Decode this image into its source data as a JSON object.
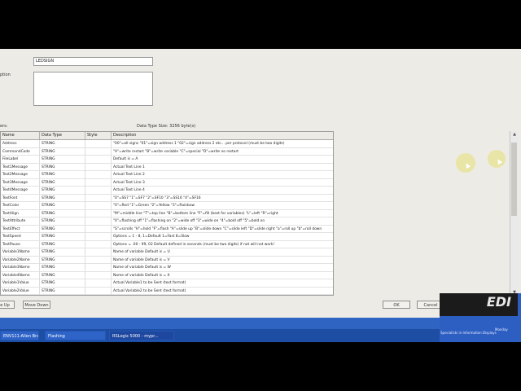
{
  "form": {
    "name_label": "",
    "name_value": "LEDSIGN",
    "description_label": "ption",
    "description_value": "",
    "members_label": "ers:",
    "data_type_size": "Data Type Size: 3256 byte(s)"
  },
  "grid": {
    "headers": [
      "Name",
      "Data Type",
      "Style",
      "Description"
    ],
    "rows": [
      {
        "name": "Address",
        "type": "STRING",
        "style": "",
        "desc": "\"00\"=all signs \"01\"=sign address 1 \"02\"=sign address 2 etc... per protocol (must be two digits)"
      },
      {
        "name": "CommandCode",
        "type": "STRING",
        "style": "",
        "desc": "\"A\"=write restart \"B\"=write variable \"C\"=special \"D\"=write no restart"
      },
      {
        "name": "FileLabel",
        "type": "STRING",
        "style": "",
        "desc": "Default is = A"
      },
      {
        "name": "Text1Message",
        "type": "STRING",
        "style": "",
        "desc": "Actual Text Line 1"
      },
      {
        "name": "Text2Message",
        "type": "STRING",
        "style": "",
        "desc": "Actual Text Line 2"
      },
      {
        "name": "Text3Message",
        "type": "STRING",
        "style": "",
        "desc": "Actual Text Line 3"
      },
      {
        "name": "Text4Message",
        "type": "STRING",
        "style": "",
        "desc": "Actual Text Line 4"
      },
      {
        "name": "TextFont",
        "type": "STRING",
        "style": "",
        "desc": "\"0\"=SS7 \"1\"=SF7 \"2\"=SF10 \"3\"=SS16 \"4\"=SF16"
      },
      {
        "name": "TextColor",
        "type": "STRING",
        "style": "",
        "desc": "\"0\"=Red \"1\"=Green \"2\"=Yellow \"3\"=Rainbow"
      },
      {
        "name": "TextAlign",
        "type": "STRING",
        "style": "",
        "desc": "\"M\"=middle line \"T\"=top line \"B\"=bottom line \"F\"=fill (best for variables) \"L\"=left \"R\"=right"
      },
      {
        "name": "TextAttribute",
        "type": "STRING",
        "style": "",
        "desc": "\"0\"=flashing off \"1\"=flashing on \"2\"=wide off \"3\"=wide on \"4\"=bold off \"5\"=bold on"
      },
      {
        "name": "TextEffect",
        "type": "STRING",
        "style": "",
        "desc": "\"S\"=scrolls \"H\"=hold \"F\"=flash \"A\"=slide up \"B\"=slide down \"C\"=slide left \"D\"=slide right \"a\"=roll up \"b\"=roll down"
      },
      {
        "name": "TextSpeed",
        "type": "STRING",
        "style": "",
        "desc": "Options = 1 - 8, 1=Default 1=Fast 8=Slow"
      },
      {
        "name": "TextPause",
        "type": "STRING",
        "style": "",
        "desc": "Options = .00 - 99, 02 Default defined in seconds (must be two digits) if not will not work!"
      },
      {
        "name": "Variable1Name",
        "type": "STRING",
        "style": "",
        "desc": "Name of variable Default is = U"
      },
      {
        "name": "Variable2Name",
        "type": "STRING",
        "style": "",
        "desc": "Name of variable Default is = V"
      },
      {
        "name": "Variable3Name",
        "type": "STRING",
        "style": "",
        "desc": "Name of variable Default is = W"
      },
      {
        "name": "Variable4Name",
        "type": "STRING",
        "style": "",
        "desc": "Name of variable Default is = X"
      },
      {
        "name": "Variable1Value",
        "type": "STRING",
        "style": "",
        "desc": "Actual Variable1 to be Sent (text format)"
      },
      {
        "name": "Variable2Value",
        "type": "STRING",
        "style": "",
        "desc": "Actual Variable2 to be Sent (text format)"
      }
    ]
  },
  "buttons": {
    "move_up": "e Up",
    "move_down": "Move Down",
    "ok": "OK",
    "cancel": "Cancel"
  },
  "taskbar": {
    "items": [
      "ENV111-Allen Bra...",
      "Flashing",
      "RSLogix 5000 - mypr..."
    ],
    "logo": "EDI",
    "tray_day": "Monday",
    "tray_line": "Specialists in Information Displays"
  },
  "colors": {
    "taskbar": "#1d4ea3",
    "highlight": "#e9e49a",
    "dialog_bg": "#ecebe6"
  }
}
